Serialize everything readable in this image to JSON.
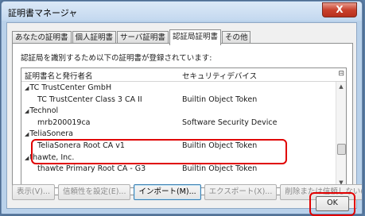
{
  "window": {
    "title": "証明書マネージャ",
    "close_label": "X"
  },
  "tabs": [
    {
      "label": "あなたの証明書",
      "active": false
    },
    {
      "label": "個人証明書",
      "active": false
    },
    {
      "label": "サーバ証明書",
      "active": false
    },
    {
      "label": "認証局証明書",
      "active": true
    },
    {
      "label": "その他",
      "active": false
    }
  ],
  "description": "認証局を識別するため以下の証明書が登録されています:",
  "list": {
    "columns": [
      "証明書名と発行者名",
      "セキュリティデバイス"
    ],
    "rows": [
      {
        "name": "TC TrustCenter GmbH",
        "device": "",
        "group": true
      },
      {
        "name": "TC TrustCenter Class 3 CA II",
        "device": "Builtin Object Token",
        "group": false
      },
      {
        "name": "Technol",
        "device": "",
        "group": true
      },
      {
        "name": "mrb200019ca",
        "device": "Software Security Device",
        "group": false
      },
      {
        "name": "TeliaSonera",
        "device": "",
        "group": true
      },
      {
        "name": "TeliaSonera Root CA v1",
        "device": "Builtin Object Token",
        "group": false
      },
      {
        "name": "thawte, Inc.",
        "device": "",
        "group": true
      },
      {
        "name": "thawte Primary Root CA - G3",
        "device": "Builtin Object Token",
        "group": false
      }
    ]
  },
  "buttons": {
    "view": "表示(V)...",
    "trust": "信頼性を設定(E)...",
    "import": "インポート(M)...",
    "export": "エクスポート(X)...",
    "delete": "削除または信頼しない(D)..."
  },
  "ok_label": "OK",
  "colors": {
    "highlight": "#e00000",
    "close_button": "#c9412d"
  }
}
